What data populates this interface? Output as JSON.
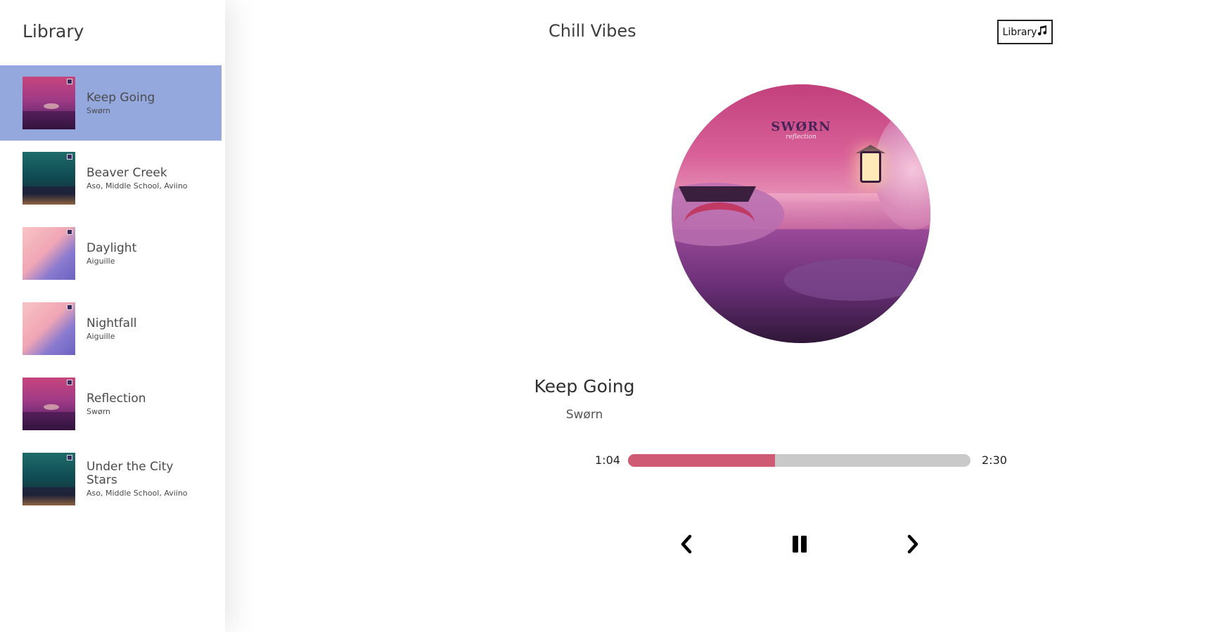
{
  "sidebar": {
    "title": "Library",
    "songs": [
      {
        "name": "Keep Going",
        "artist": "Swørn",
        "selected": true,
        "cover": "pink"
      },
      {
        "name": "Beaver Creek",
        "artist": "Aso, Middle School, Aviino",
        "selected": false,
        "cover": "teal"
      },
      {
        "name": "Daylight",
        "artist": "Aiguille",
        "selected": false,
        "cover": "peach"
      },
      {
        "name": "Nightfall",
        "artist": "Aiguille",
        "selected": false,
        "cover": "peach"
      },
      {
        "name": "Reflection",
        "artist": "Swørn",
        "selected": false,
        "cover": "pink"
      },
      {
        "name": "Under the City Stars",
        "artist": "Aso, Middle School, Aviino",
        "selected": false,
        "cover": "teal"
      }
    ]
  },
  "header": {
    "title": "Chill Vibes",
    "library_button_label": "Library",
    "library_button_icon": "music-note-icon"
  },
  "player": {
    "album_art": {
      "logo": "SWØRN",
      "subtitle": "reflection"
    },
    "track_title": "Keep Going",
    "track_artist": "Swørn",
    "current_time": "1:04",
    "total_time": "2:30",
    "progress_fraction": 0.43,
    "controls": {
      "previous_icon": "chevron-left-icon",
      "play_pause_icon": "pause-icon",
      "next_icon": "chevron-right-icon"
    }
  },
  "colors": {
    "selected_item": "#95a8de",
    "progress_fill": "#cf5a74",
    "progress_track": "#c9c9c9"
  }
}
